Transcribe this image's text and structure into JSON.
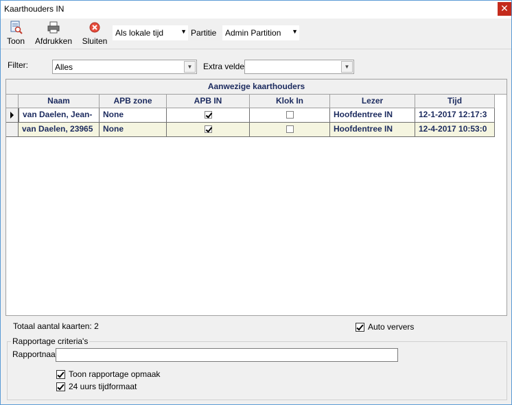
{
  "window": {
    "title": "Kaarthouders IN",
    "close": "✕"
  },
  "toolbar": {
    "show_label": "Toon",
    "print_label": "Afdrukken",
    "close_label": "Sluiten",
    "time_mode": "Als lokale tijd",
    "partition_label": "Partitie",
    "partition_value": "Admin Partition"
  },
  "filter": {
    "label": "Filter:",
    "value": "Alles",
    "extra_label": "Extra velden",
    "extra_value": ""
  },
  "grid": {
    "caption": "Aanwezige kaarthouders",
    "columns": [
      "Naam",
      "APB zone",
      "APB IN",
      "Klok In",
      "Lezer",
      "Tijd"
    ],
    "rows": [
      {
        "name": "van Daelen, Jean-",
        "apb_zone": "None",
        "apb_in": true,
        "klok_in": false,
        "lezer": "Hoofdentree IN",
        "tijd": "12-1-2017 12:17:3",
        "selected": true
      },
      {
        "name": "van Daelen, 23965",
        "apb_zone": "None",
        "apb_in": true,
        "klok_in": false,
        "lezer": "Hoofdentree IN",
        "tijd": "12-4-2017 10:53:0",
        "selected": false
      }
    ]
  },
  "footer": {
    "total": "Totaal aantal kaarten: 2",
    "auto_refresh_label": "Auto ververs",
    "auto_refresh": true
  },
  "report": {
    "group_label": "Rapportage criteria's",
    "name_label": "Rapportnaam",
    "name_value": "",
    "show_layout_label": "Toon rapportage opmaak",
    "show_layout": true,
    "time24_label": "24 uurs tijdformaat",
    "time24": true
  },
  "colors": {
    "accent": "#5a9bd5",
    "grid_text": "#1b2a5e",
    "row_alt": "#f5f5e0",
    "close_red": "#c42b1c"
  },
  "icons": {
    "show": "document-view-icon",
    "print": "printer-icon",
    "close": "close-circle-icon"
  }
}
